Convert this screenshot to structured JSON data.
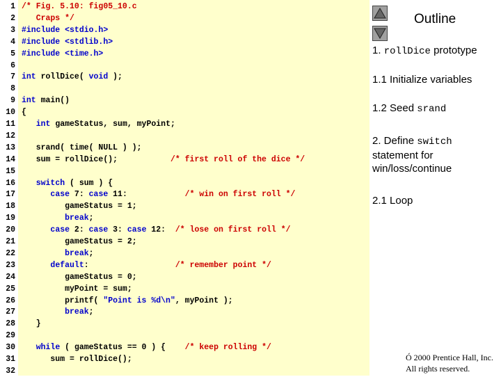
{
  "code_lines": [
    {
      "n": "1",
      "segments": [
        {
          "t": "/* Fig. 5.10: fig05_10.c",
          "c": "cm"
        }
      ]
    },
    {
      "n": "2",
      "segments": [
        {
          "t": "   Craps */",
          "c": "cm"
        }
      ]
    },
    {
      "n": "3",
      "segments": [
        {
          "t": "#include <stdio.h>",
          "c": "kw"
        }
      ]
    },
    {
      "n": "4",
      "segments": [
        {
          "t": "#include <stdlib.h>",
          "c": "kw"
        }
      ]
    },
    {
      "n": "5",
      "segments": [
        {
          "t": "#include <time.h>",
          "c": "kw"
        }
      ]
    },
    {
      "n": "6",
      "segments": []
    },
    {
      "n": "7",
      "segments": [
        {
          "t": "int",
          "c": "kw"
        },
        {
          "t": " rollDice( ",
          "c": ""
        },
        {
          "t": "void",
          "c": "kw"
        },
        {
          "t": " );",
          "c": ""
        }
      ]
    },
    {
      "n": "8",
      "segments": []
    },
    {
      "n": "9",
      "segments": [
        {
          "t": "int",
          "c": "kw"
        },
        {
          "t": " main()",
          "c": ""
        }
      ]
    },
    {
      "n": "10",
      "segments": [
        {
          "t": "{",
          "c": ""
        }
      ]
    },
    {
      "n": "11",
      "segments": [
        {
          "t": "   ",
          "c": ""
        },
        {
          "t": "int",
          "c": "kw"
        },
        {
          "t": " gameStatus, sum, myPoint;",
          "c": ""
        }
      ]
    },
    {
      "n": "12",
      "segments": []
    },
    {
      "n": "13",
      "segments": [
        {
          "t": "   srand( time( NULL ) );",
          "c": ""
        }
      ]
    },
    {
      "n": "14",
      "segments": [
        {
          "t": "   sum = rollDice();           ",
          "c": ""
        },
        {
          "t": "/* first roll of the dice */",
          "c": "cm"
        }
      ]
    },
    {
      "n": "15",
      "segments": []
    },
    {
      "n": "16",
      "segments": [
        {
          "t": "   ",
          "c": ""
        },
        {
          "t": "switch",
          "c": "kw"
        },
        {
          "t": " ( sum ) {",
          "c": ""
        }
      ]
    },
    {
      "n": "17",
      "segments": [
        {
          "t": "      ",
          "c": ""
        },
        {
          "t": "case",
          "c": "kw"
        },
        {
          "t": " 7: ",
          "c": ""
        },
        {
          "t": "case",
          "c": "kw"
        },
        {
          "t": " 11:            ",
          "c": ""
        },
        {
          "t": "/* win on first roll */",
          "c": "cm"
        }
      ]
    },
    {
      "n": "18",
      "segments": [
        {
          "t": "         gameStatus = 1;",
          "c": ""
        }
      ]
    },
    {
      "n": "19",
      "segments": [
        {
          "t": "         ",
          "c": ""
        },
        {
          "t": "break",
          "c": "kw"
        },
        {
          "t": ";",
          "c": ""
        }
      ]
    },
    {
      "n": "20",
      "segments": [
        {
          "t": "      ",
          "c": ""
        },
        {
          "t": "case",
          "c": "kw"
        },
        {
          "t": " 2: ",
          "c": ""
        },
        {
          "t": "case",
          "c": "kw"
        },
        {
          "t": " 3: ",
          "c": ""
        },
        {
          "t": "case",
          "c": "kw"
        },
        {
          "t": " 12:  ",
          "c": ""
        },
        {
          "t": "/* lose on first roll */",
          "c": "cm"
        }
      ]
    },
    {
      "n": "21",
      "segments": [
        {
          "t": "         gameStatus = 2;",
          "c": ""
        }
      ]
    },
    {
      "n": "22",
      "segments": [
        {
          "t": "         ",
          "c": ""
        },
        {
          "t": "break",
          "c": "kw"
        },
        {
          "t": ";",
          "c": ""
        }
      ]
    },
    {
      "n": "23",
      "segments": [
        {
          "t": "      ",
          "c": ""
        },
        {
          "t": "default",
          "c": "kw"
        },
        {
          "t": ":                  ",
          "c": ""
        },
        {
          "t": "/* remember point */",
          "c": "cm"
        }
      ]
    },
    {
      "n": "24",
      "segments": [
        {
          "t": "         gameStatus = 0;",
          "c": ""
        }
      ]
    },
    {
      "n": "25",
      "segments": [
        {
          "t": "         myPoint = sum;",
          "c": ""
        }
      ]
    },
    {
      "n": "26",
      "segments": [
        {
          "t": "         printf( ",
          "c": ""
        },
        {
          "t": "\"Point is %d\\n\"",
          "c": "kw"
        },
        {
          "t": ", myPoint );",
          "c": ""
        }
      ]
    },
    {
      "n": "27",
      "segments": [
        {
          "t": "         ",
          "c": ""
        },
        {
          "t": "break",
          "c": "kw"
        },
        {
          "t": ";",
          "c": ""
        }
      ]
    },
    {
      "n": "28",
      "segments": [
        {
          "t": "   }",
          "c": ""
        }
      ]
    },
    {
      "n": "29",
      "segments": []
    },
    {
      "n": "30",
      "segments": [
        {
          "t": "   ",
          "c": ""
        },
        {
          "t": "while",
          "c": "kw"
        },
        {
          "t": " ( gameStatus == 0 ) {    ",
          "c": ""
        },
        {
          "t": "/* keep rolling */",
          "c": "cm"
        }
      ]
    },
    {
      "n": "31",
      "segments": [
        {
          "t": "      sum = rollDice();",
          "c": ""
        }
      ]
    },
    {
      "n": "32",
      "segments": []
    }
  ],
  "nav": {
    "up_icon": "triangle-up-icon",
    "down_icon": "triangle-down-icon"
  },
  "outline": {
    "title": "Outline",
    "items": [
      {
        "parts": [
          {
            "t": "1. ",
            "mono": false
          },
          {
            "t": "rollDice",
            "mono": true
          },
          {
            "t": " prototype",
            "mono": false
          }
        ]
      },
      {
        "parts": [
          {
            "t": "1.1  Initialize variables",
            "mono": false
          }
        ]
      },
      {
        "parts": [
          {
            "t": "1.2  Seed ",
            "mono": false
          },
          {
            "t": "srand",
            "mono": true
          }
        ]
      },
      {
        "parts": [
          {
            "t": "2.  Define ",
            "mono": false
          },
          {
            "t": "switch",
            "mono": true
          },
          {
            "t": " statement for win/loss/continue",
            "mono": false
          }
        ]
      },
      {
        "parts": [
          {
            "t": "2.1 Loop",
            "mono": false
          }
        ]
      }
    ]
  },
  "copyright": {
    "line1": "Ó 2000 Prentice Hall, Inc.",
    "line2": "All rights reserved."
  },
  "colors": {
    "code_bg": "#ffffcc",
    "keyword": "#0000cc",
    "comment": "#cc0000",
    "nav_button": "#a0a0a0"
  }
}
